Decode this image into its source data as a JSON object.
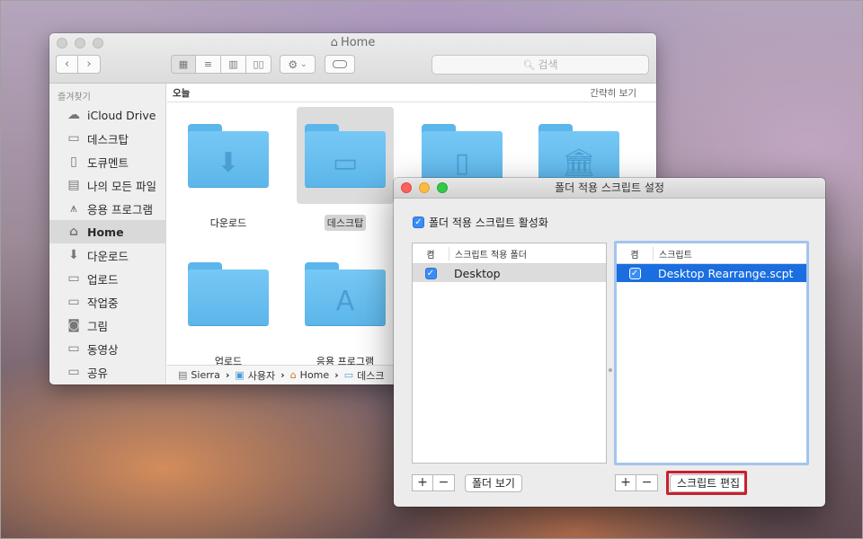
{
  "finder": {
    "title": "Home",
    "search_placeholder": "검색",
    "sidebar": {
      "section": "즐겨찾기",
      "items": [
        {
          "label": "iCloud Drive",
          "icon": "cloud-icon"
        },
        {
          "label": "데스크탑",
          "icon": "desktop-icon"
        },
        {
          "label": "도큐멘트",
          "icon": "document-icon"
        },
        {
          "label": "나의 모든 파일",
          "icon": "all-files-icon"
        },
        {
          "label": "응용 프로그램",
          "icon": "applications-icon"
        },
        {
          "label": "Home",
          "icon": "home-icon",
          "active": true
        },
        {
          "label": "다운로드",
          "icon": "download-icon"
        },
        {
          "label": "업로드",
          "icon": "folder-icon"
        },
        {
          "label": "작업중",
          "icon": "folder-icon"
        },
        {
          "label": "그림",
          "icon": "camera-icon"
        },
        {
          "label": "동영상",
          "icon": "folder-icon"
        },
        {
          "label": "공유",
          "icon": "folder-icon"
        }
      ]
    },
    "group_title": "오늘",
    "group_action": "간략히 보기",
    "items": [
      {
        "label": "다운로드",
        "icon": "download-folder-icon"
      },
      {
        "label": "데스크탑",
        "icon": "desktop-folder-icon",
        "selected": true
      },
      {
        "label": "",
        "icon": "documents-folder-icon"
      },
      {
        "label": "",
        "icon": "library-folder-icon"
      },
      {
        "label": "업로드",
        "icon": "folder-icon"
      },
      {
        "label": "응용 프로그램",
        "icon": "applications-folder-icon"
      }
    ],
    "path": [
      "Sierra",
      "사용자",
      "Home",
      "데스크"
    ]
  },
  "dialog": {
    "title": "폴더 적용 스크립트 설정",
    "enable_label": "폴더 적용 스크립트 활성화",
    "enable_checked": true,
    "left_table": {
      "col_on": "켬",
      "col_name": "스크립트 적용 폴더",
      "rows": [
        {
          "checked": true,
          "name": "Desktop"
        }
      ]
    },
    "right_table": {
      "col_on": "켬",
      "col_name": "스크립트",
      "rows": [
        {
          "checked": true,
          "name": "Desktop Rearrange.scpt"
        }
      ]
    },
    "plus": "+",
    "minus": "−",
    "show_folder_button": "폴더 보기",
    "edit_script_button": "스크립트 편집",
    "highlight_color": "#c8202e"
  }
}
